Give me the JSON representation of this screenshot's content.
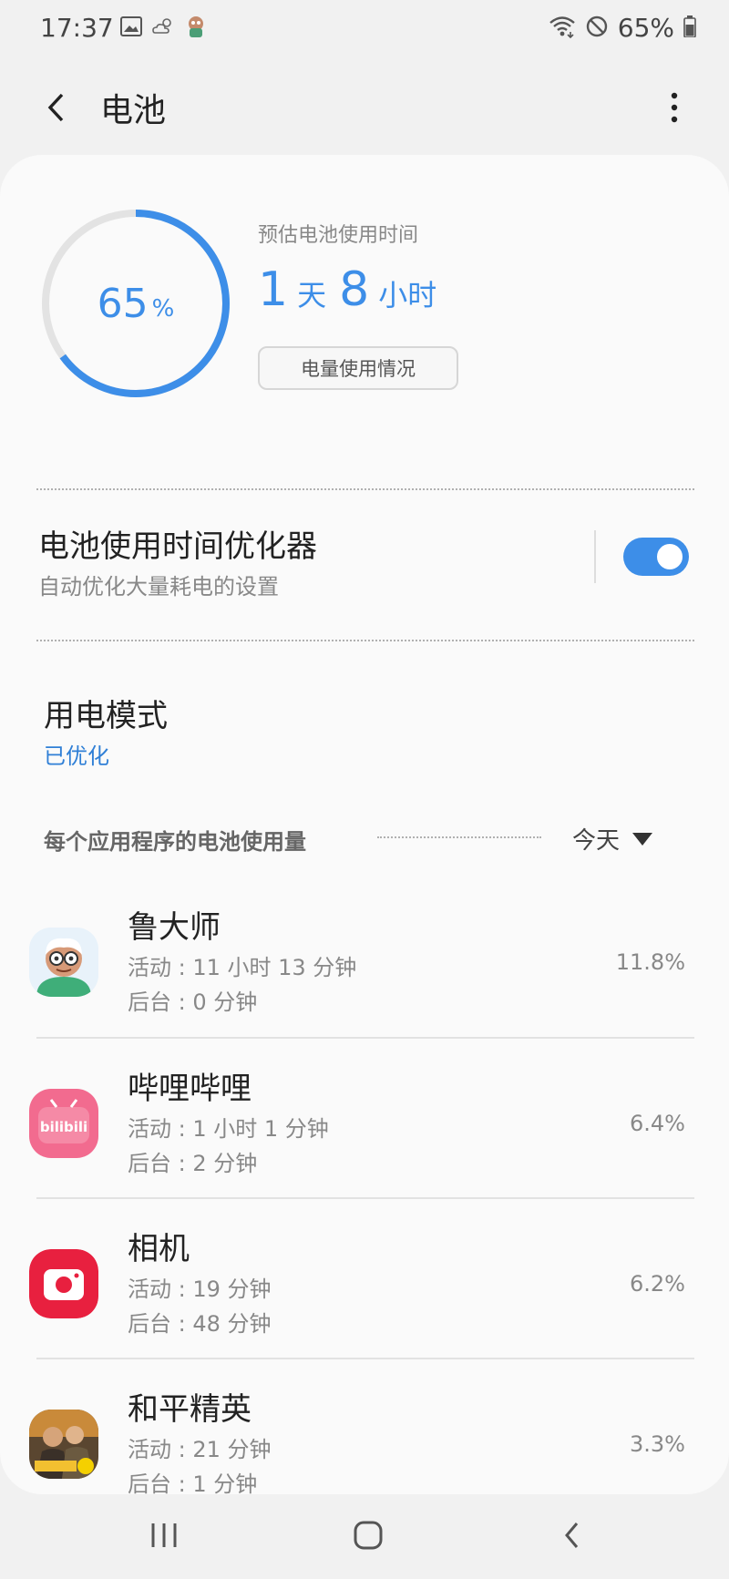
{
  "status": {
    "time": "17:37",
    "battery_pct": "65%",
    "icons_left": [
      "gallery-icon",
      "weather-icon",
      "app-notification-icon"
    ],
    "icons_right": [
      "wifi-icon",
      "do-not-disturb-icon",
      "battery-icon"
    ]
  },
  "header": {
    "title": "电池"
  },
  "battery": {
    "level_pct": 65,
    "ring_value": "65",
    "ring_unit": "%",
    "estimate_label": "预估电池使用时间",
    "estimate_days": "1",
    "estimate_days_unit": "天",
    "estimate_hours": "8",
    "estimate_hours_unit": "小时",
    "usage_button": "电量使用情况"
  },
  "optimizer": {
    "title": "电池使用时间优化器",
    "subtitle": "自动优化大量耗电的设置",
    "enabled": true
  },
  "power_mode": {
    "title": "用电模式",
    "value": "已优化"
  },
  "per_app": {
    "label": "每个应用程序的电池使用量",
    "period": "今天"
  },
  "apps": [
    {
      "name": "鲁大师",
      "active": "活动 : 11 小时 13 分钟",
      "background": "后台 : 0 分钟",
      "percent": "11.8%",
      "icon": "ludashi-icon"
    },
    {
      "name": "哔哩哔哩",
      "active": "活动 : 1 小时 1 分钟",
      "background": "后台 : 2 分钟",
      "percent": "6.4%",
      "icon": "bilibili-icon"
    },
    {
      "name": "相机",
      "active": "活动 : 19 分钟",
      "background": "后台 : 48 分钟",
      "percent": "6.2%",
      "icon": "camera-icon"
    },
    {
      "name": "和平精英",
      "active": "活动 : 21 分钟",
      "background": "后台 : 1 分钟",
      "percent": "3.3%",
      "icon": "peacekeeper-elite-icon"
    }
  ],
  "colors": {
    "accent": "#3d8ee8",
    "ring_track": "#e3e3e3",
    "camera_red": "#e8203f",
    "bilibili_pink": "#f26b8f"
  }
}
